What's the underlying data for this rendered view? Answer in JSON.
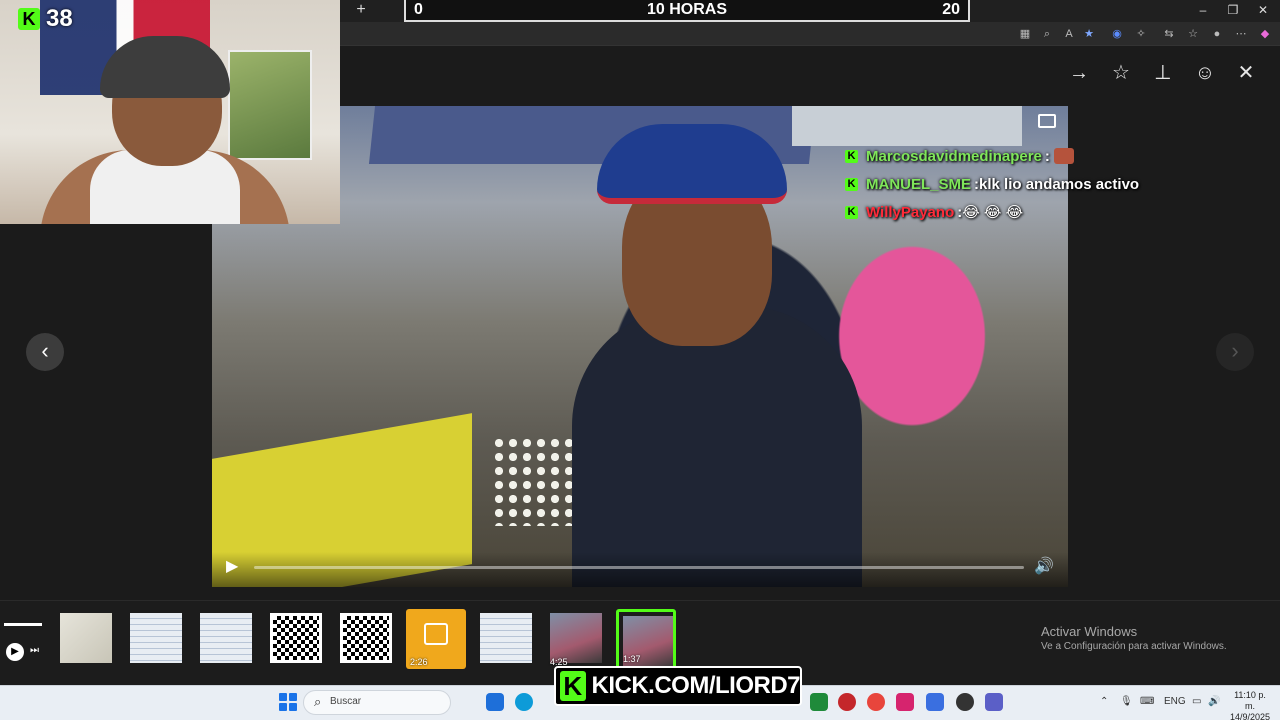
{
  "scoreboard": {
    "left": "0",
    "center": "10 HORAS",
    "right": "20"
  },
  "kick_counter": {
    "badge": "K",
    "count": "38"
  },
  "chat": [
    {
      "user": "Marcosdavidmedinapere",
      "sep": " :",
      "message": "",
      "user_color": "#7fe65a",
      "emote": true
    },
    {
      "user": "MANUEL_SME",
      "sep": " :",
      "message": " klk lio andamos activo",
      "user_color": "#7fe65a",
      "emote": false
    },
    {
      "user": "WillyPayano",
      "sep": " :",
      "message": " 😂 😂 😂",
      "user_color": "#ff2b3a",
      "emote": false
    }
  ],
  "video": {
    "progress": 0.0
  },
  "thumbnails": [
    {
      "kind": "paper",
      "label": ""
    },
    {
      "kind": "doc",
      "label": ""
    },
    {
      "kind": "doc",
      "label": ""
    },
    {
      "kind": "qr",
      "label": ""
    },
    {
      "kind": "qr",
      "label": ""
    },
    {
      "kind": "image",
      "label": "2:26"
    },
    {
      "kind": "doc",
      "label": ""
    },
    {
      "kind": "photo",
      "label": "4:25"
    },
    {
      "kind": "photo",
      "label": "1:37",
      "selected": true
    }
  ],
  "activate_windows": {
    "title": "Activar Windows",
    "subtitle": "Ve a Configuración para activar Windows."
  },
  "kick_banner": {
    "k": "K",
    "text": "KICK.COM/LIORD7"
  },
  "taskbar": {
    "search_placeholder": "Buscar",
    "language": "ENG",
    "time": "11:10 p. m.",
    "date": "14/9/2025"
  },
  "colors": {
    "kick_green": "#53fc18",
    "accent": "#1a73e8"
  },
  "icons": {
    "lightbox": [
      "arrow-right-icon",
      "star-icon",
      "pin-icon",
      "emoji-icon",
      "close-icon"
    ],
    "nav": [
      "chevron-left-icon",
      "chevron-right-icon"
    ]
  }
}
